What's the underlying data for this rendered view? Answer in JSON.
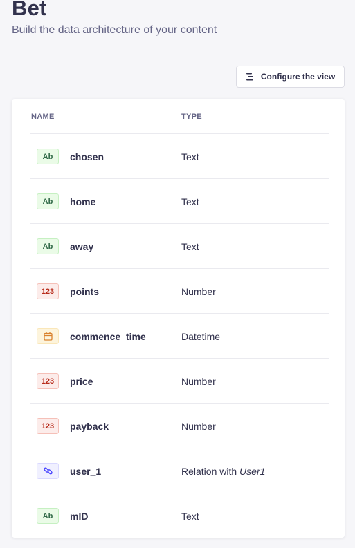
{
  "header": {
    "title": "Bet",
    "subtitle": "Build the data architecture of your content"
  },
  "toolbar": {
    "configure_label": "Configure the view"
  },
  "table": {
    "columns": {
      "name": "NAME",
      "type": "TYPE"
    },
    "rows": [
      {
        "badge": "Ab",
        "kind": "text",
        "name": "chosen",
        "type": "Text",
        "target": ""
      },
      {
        "badge": "Ab",
        "kind": "text",
        "name": "home",
        "type": "Text",
        "target": ""
      },
      {
        "badge": "Ab",
        "kind": "text",
        "name": "away",
        "type": "Text",
        "target": ""
      },
      {
        "badge": "123",
        "kind": "number",
        "name": "points",
        "type": "Number",
        "target": ""
      },
      {
        "badge": "",
        "kind": "date",
        "name": "commence_time",
        "type": "Datetime",
        "target": ""
      },
      {
        "badge": "123",
        "kind": "number",
        "name": "price",
        "type": "Number",
        "target": ""
      },
      {
        "badge": "123",
        "kind": "number",
        "name": "payback",
        "type": "Number",
        "target": ""
      },
      {
        "badge": "",
        "kind": "relation",
        "name": "user_1",
        "type": "Relation with ",
        "target": "User1"
      },
      {
        "badge": "Ab",
        "kind": "text",
        "name": "mID",
        "type": "Text",
        "target": ""
      }
    ]
  },
  "icons": {
    "configure": "list-settings-icon",
    "date": "calendar-icon",
    "relation": "link-icon"
  },
  "colors": {
    "text_badge": "#eafbe7",
    "number_badge": "#fcecea",
    "date_badge": "#fdf4dc",
    "relation_badge": "#f0f0ff",
    "primary_text": "#32324d",
    "muted_text": "#666687",
    "background": "#f6f6f9"
  }
}
